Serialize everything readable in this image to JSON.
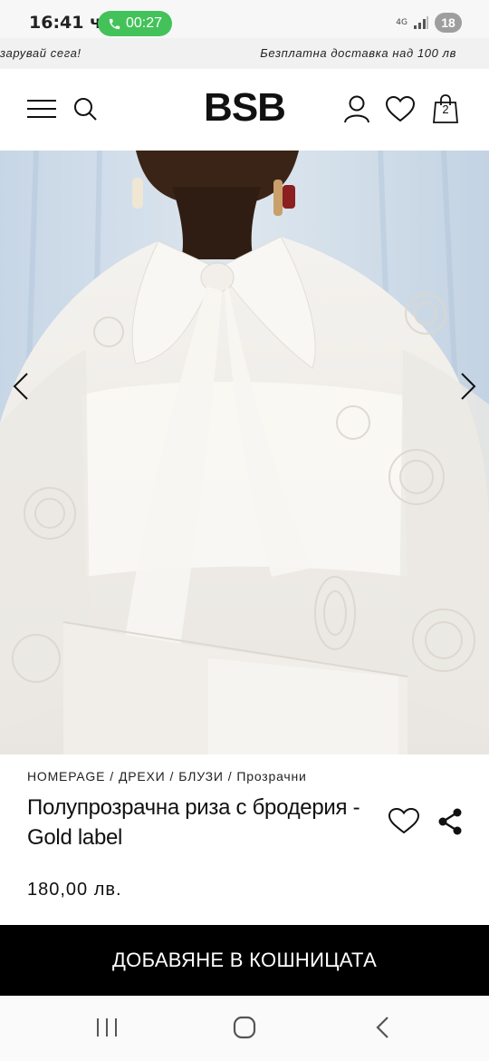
{
  "status_bar": {
    "time": "16:41 ч.",
    "call_duration": "00:27",
    "network": "4G",
    "battery": "18"
  },
  "promo": {
    "left_text": "зарувай сега!",
    "right_text": "Безплатна доставка над 100 лв"
  },
  "header": {
    "logo": "BSB",
    "cart_count": "2"
  },
  "breadcrumb": [
    "HOMEPAGE",
    "/",
    "ДРЕХИ",
    "/",
    "БЛУЗИ",
    "/",
    "Прозрачни"
  ],
  "product": {
    "title": "Полупрозрачна риза с бродерия - Gold label",
    "price": "180,00 лв."
  },
  "cta": {
    "add_to_cart": "ДОБАВЯНЕ В КОШНИЦАТА"
  },
  "icons": {
    "menu": "menu-icon",
    "search": "search-icon",
    "account": "user-icon",
    "wishlist": "heart-icon",
    "cart": "shopping-bag-icon",
    "share": "share-icon",
    "prev": "chevron-left-icon",
    "next": "chevron-right-icon"
  },
  "colors": {
    "brand_black": "#000000",
    "call_green": "#43c25a",
    "background": "#ffffff"
  }
}
